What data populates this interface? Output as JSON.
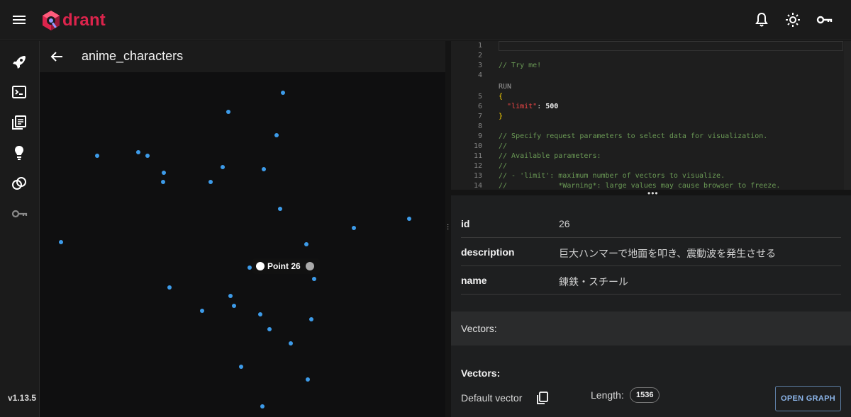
{
  "app": {
    "logo_text": "drant",
    "brand_color": "#dc244c",
    "version": "v1.13.5"
  },
  "topbar": {
    "icons": [
      "bell-icon",
      "sun-icon",
      "key-icon"
    ]
  },
  "leftnav": {
    "icons": [
      "rocket-icon",
      "console-icon",
      "collections-icon",
      "lightbulb-icon",
      "integrations-icon",
      "api-key-icon"
    ]
  },
  "collection": {
    "title": "anime_characters"
  },
  "scatter": {
    "point_color": "#3d9be9",
    "hover_label": "Point 26"
  },
  "editor": {
    "lines": [
      {
        "n": "1",
        "segments": []
      },
      {
        "n": "2",
        "segments": []
      },
      {
        "n": "3",
        "segments": [
          {
            "t": "// Try me!",
            "c": "comment"
          }
        ]
      },
      {
        "n": "4",
        "segments": []
      },
      {
        "n": "",
        "segments": [
          {
            "t": "RUN",
            "c": "run"
          }
        ]
      },
      {
        "n": "5",
        "segments": [
          {
            "t": "{",
            "c": "brace"
          }
        ]
      },
      {
        "n": "6",
        "segments": [
          {
            "t": "  ",
            "c": "plain"
          },
          {
            "t": "\"limit\"",
            "c": "key"
          },
          {
            "t": ": ",
            "c": "plain"
          },
          {
            "t": "500",
            "c": "num"
          }
        ]
      },
      {
        "n": "7",
        "segments": [
          {
            "t": "}",
            "c": "brace"
          }
        ]
      },
      {
        "n": "8",
        "segments": []
      },
      {
        "n": "9",
        "segments": [
          {
            "t": "// Specify request parameters to select data for visualization.",
            "c": "comment"
          }
        ]
      },
      {
        "n": "10",
        "segments": [
          {
            "t": "//",
            "c": "comment"
          }
        ]
      },
      {
        "n": "11",
        "segments": [
          {
            "t": "// Available parameters:",
            "c": "comment"
          }
        ]
      },
      {
        "n": "12",
        "segments": [
          {
            "t": "//",
            "c": "comment"
          }
        ]
      },
      {
        "n": "13",
        "segments": [
          {
            "t": "// - 'limit': maximum number of vectors to visualize.",
            "c": "comment"
          }
        ]
      },
      {
        "n": "14",
        "segments": [
          {
            "t": "//            *Warning*: large values may cause browser to freeze.",
            "c": "comment"
          }
        ]
      }
    ]
  },
  "details": {
    "fields": [
      {
        "key": "id",
        "value": "26"
      },
      {
        "key": "description",
        "value": "巨大ハンマーで地面を叩き、震動波を発生させる"
      },
      {
        "key": "name",
        "value": "鍊鉄・スチール"
      }
    ],
    "vectors_band_label": "Vectors:",
    "vectors_title": "Vectors:",
    "vector_name": "Default vector",
    "length_label": "Length:",
    "length_value": "1536",
    "open_graph_label": "OPEN GRAPH"
  }
}
